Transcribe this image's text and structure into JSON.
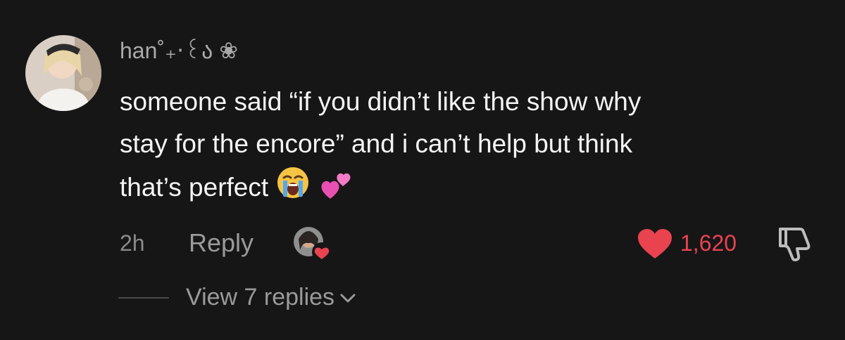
{
  "comment": {
    "username": "han˚₊‧꒰ა ❀",
    "text_lines": [
      "someone said “if you didn’t like the show why",
      "stay for the encore” and i can’t help but think",
      "that’s perfect"
    ],
    "emojis": [
      "loudly-crying-face",
      "two-hearts"
    ],
    "time": "2h",
    "reply_label": "Reply",
    "like_count": "1,620",
    "liked": true,
    "replies": {
      "label": "View 7 replies"
    }
  },
  "icons": {
    "like": "heart-icon",
    "dislike": "thumbs-down-icon",
    "expand": "chevron-down-icon",
    "creator_liked": "creator-liked-avatar"
  },
  "colors": {
    "background": "#161616",
    "text": "#f5f5f5",
    "muted": "#9a9a9a",
    "like": "#e8434f"
  }
}
